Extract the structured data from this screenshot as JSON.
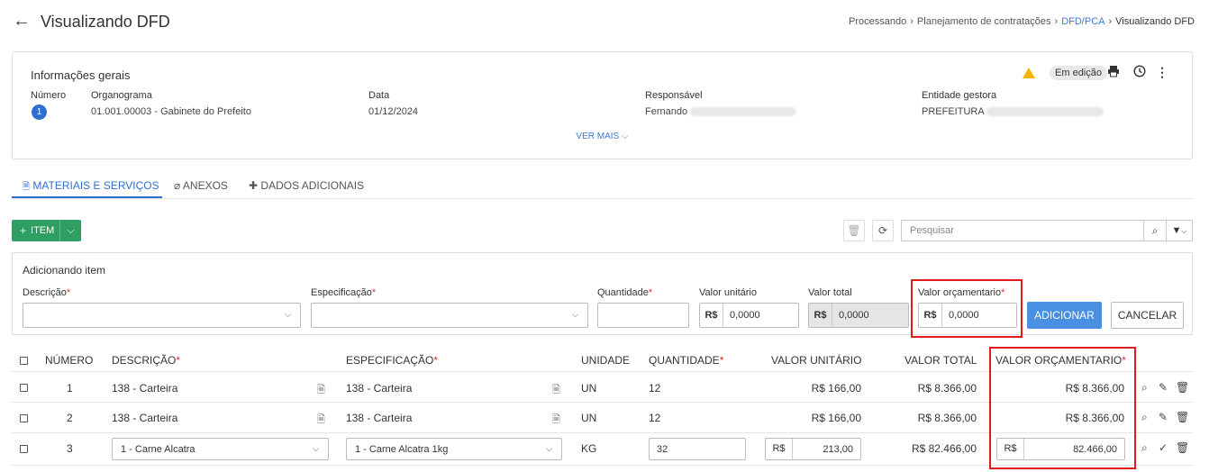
{
  "header": {
    "title": "Visualizando DFD",
    "breadcrumb": [
      "Processando",
      "Planejamento de contratações",
      "DFD/PCA",
      "Visualizando DFD"
    ]
  },
  "info": {
    "title": "Informações gerais",
    "status": "Em edição",
    "fields": {
      "numero_label": "Número",
      "numero_value": "1",
      "organograma_label": "Organograma",
      "organograma_value": "01.001.00003 - Gabinete do Prefeito",
      "data_label": "Data",
      "data_value": "01/12/2024",
      "responsavel_label": "Responsável",
      "responsavel_value": "Fernando",
      "entidade_label": "Entidade gestora",
      "entidade_value": "PREFEITURA"
    },
    "ver_mais": "VER MAIS"
  },
  "tabs": [
    {
      "label": "MATERIAIS E SERVIÇOS",
      "icon": "document-icon"
    },
    {
      "label": "ANEXOS",
      "icon": "paperclip-icon"
    },
    {
      "label": "DADOS ADICIONAIS",
      "icon": "puzzle-icon"
    }
  ],
  "toolbar": {
    "add_item_label": "ITEM",
    "search_placeholder": "Pesquisar"
  },
  "add_panel": {
    "title": "Adicionando item",
    "descricao_label": "Descrição",
    "especificacao_label": "Especificação",
    "quantidade_label": "Quantidade",
    "valor_unitario_label": "Valor unitário",
    "valor_unitario_value": "0,0000",
    "valor_total_label": "Valor total",
    "valor_total_value": "0,0000",
    "valor_orcamentario_label": "Valor orçamentario",
    "valor_orcamentario_value": "0,0000",
    "currency": "R$",
    "required_mark": "*",
    "adicionar_label": "ADICIONAR",
    "cancelar_label": "CANCELAR"
  },
  "table": {
    "headers": {
      "numero": "NÚMERO",
      "descricao": "DESCRIÇÃO",
      "especificacao": "ESPECIFICAÇÃO",
      "unidade": "UNIDADE",
      "quantidade": "QUANTIDADE",
      "valor_unitario": "VALOR UNITÁRIO",
      "valor_total": "VALOR TOTAL",
      "valor_orcamentario": "VALOR ORÇAMENTARIO"
    },
    "rows": [
      {
        "numero": "1",
        "descricao": "138 - Carteira",
        "especificacao": "138 - Carteira",
        "unidade": "UN",
        "quantidade": "12",
        "valor_unitario": "R$ 166,00",
        "valor_total": "R$ 8.366,00",
        "valor_orcamentario": "R$ 8.366,00"
      },
      {
        "numero": "2",
        "descricao": "138 - Carteira",
        "especificacao": "138 - Carteira",
        "unidade": "UN",
        "quantidade": "12",
        "valor_unitario": "R$ 166,00",
        "valor_total": "R$ 8.366,00",
        "valor_orcamentario": "R$ 8.366,00"
      },
      {
        "numero": "3",
        "descricao": "1 - Carne Alcatra",
        "especificacao": "1 - Carne Alcatra 1kg",
        "unidade": "KG",
        "quantidade": "32",
        "valor_unitario": "213,00",
        "valor_total": "R$ 82.466,00",
        "valor_orcamentario": "82.466,00",
        "currency": "R$"
      }
    ]
  },
  "colors": {
    "accent": "#2f6fd1",
    "primary_button": "#4a90e2",
    "success": "#2e9e62",
    "highlight": "#e01b1b",
    "warning": "#f0b400"
  }
}
